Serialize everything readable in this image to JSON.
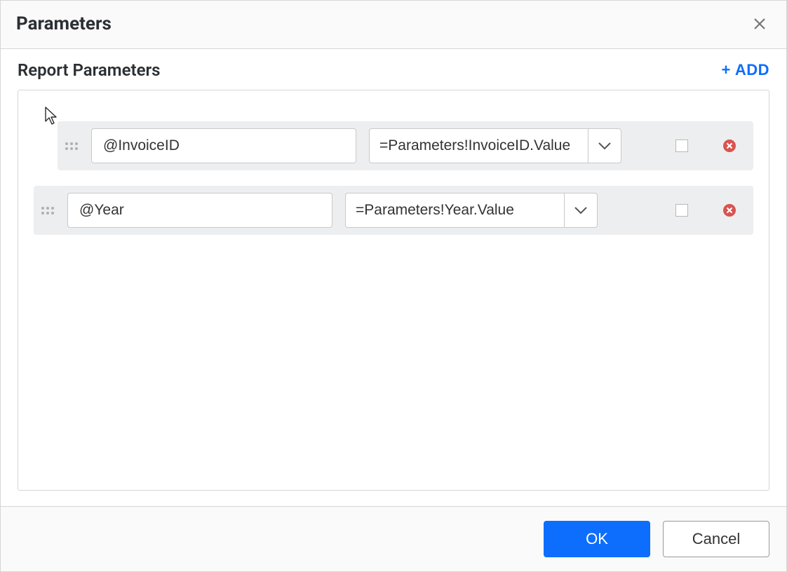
{
  "dialog": {
    "title": "Parameters",
    "section_title": "Report Parameters",
    "add_label": "ADD"
  },
  "parameters": [
    {
      "name": "@InvoiceID",
      "value": "=Parameters!InvoiceID.Value",
      "checked": false
    },
    {
      "name": "@Year",
      "value": "=Parameters!Year.Value",
      "checked": false
    }
  ],
  "footer": {
    "ok_label": "OK",
    "cancel_label": "Cancel"
  }
}
